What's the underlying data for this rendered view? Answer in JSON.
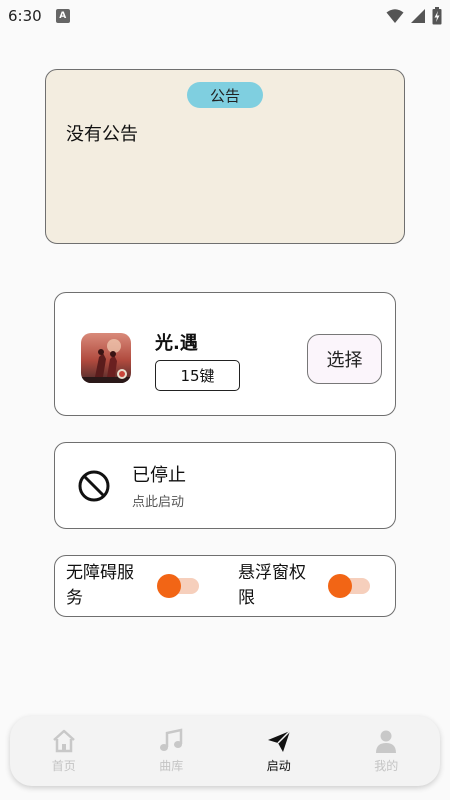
{
  "status_bar": {
    "time": "6:30",
    "notification_icon_letter": "A",
    "icons": [
      "wifi-icon",
      "signal-icon",
      "battery-charging-icon"
    ]
  },
  "announcement": {
    "badge": "公告",
    "text": "没有公告"
  },
  "game": {
    "name": "光.遇",
    "keys": "15键",
    "select_label": "选择",
    "icon": "game-cover-icon"
  },
  "service_state": {
    "title": "已停止",
    "subtitle": "点此启动",
    "icon": "stopped-icon"
  },
  "permissions": {
    "accessibility_label": "无障碍服务",
    "accessibility_enabled": true,
    "overlay_label": "悬浮窗权限",
    "overlay_enabled": true,
    "accent_color": "#f26515"
  },
  "nav": {
    "items": [
      {
        "label": "首页",
        "icon": "home-icon",
        "active": false
      },
      {
        "label": "曲库",
        "icon": "music-note-icon",
        "active": false
      },
      {
        "label": "启动",
        "icon": "send-icon",
        "active": true
      },
      {
        "label": "我的",
        "icon": "person-icon",
        "active": false
      }
    ]
  }
}
